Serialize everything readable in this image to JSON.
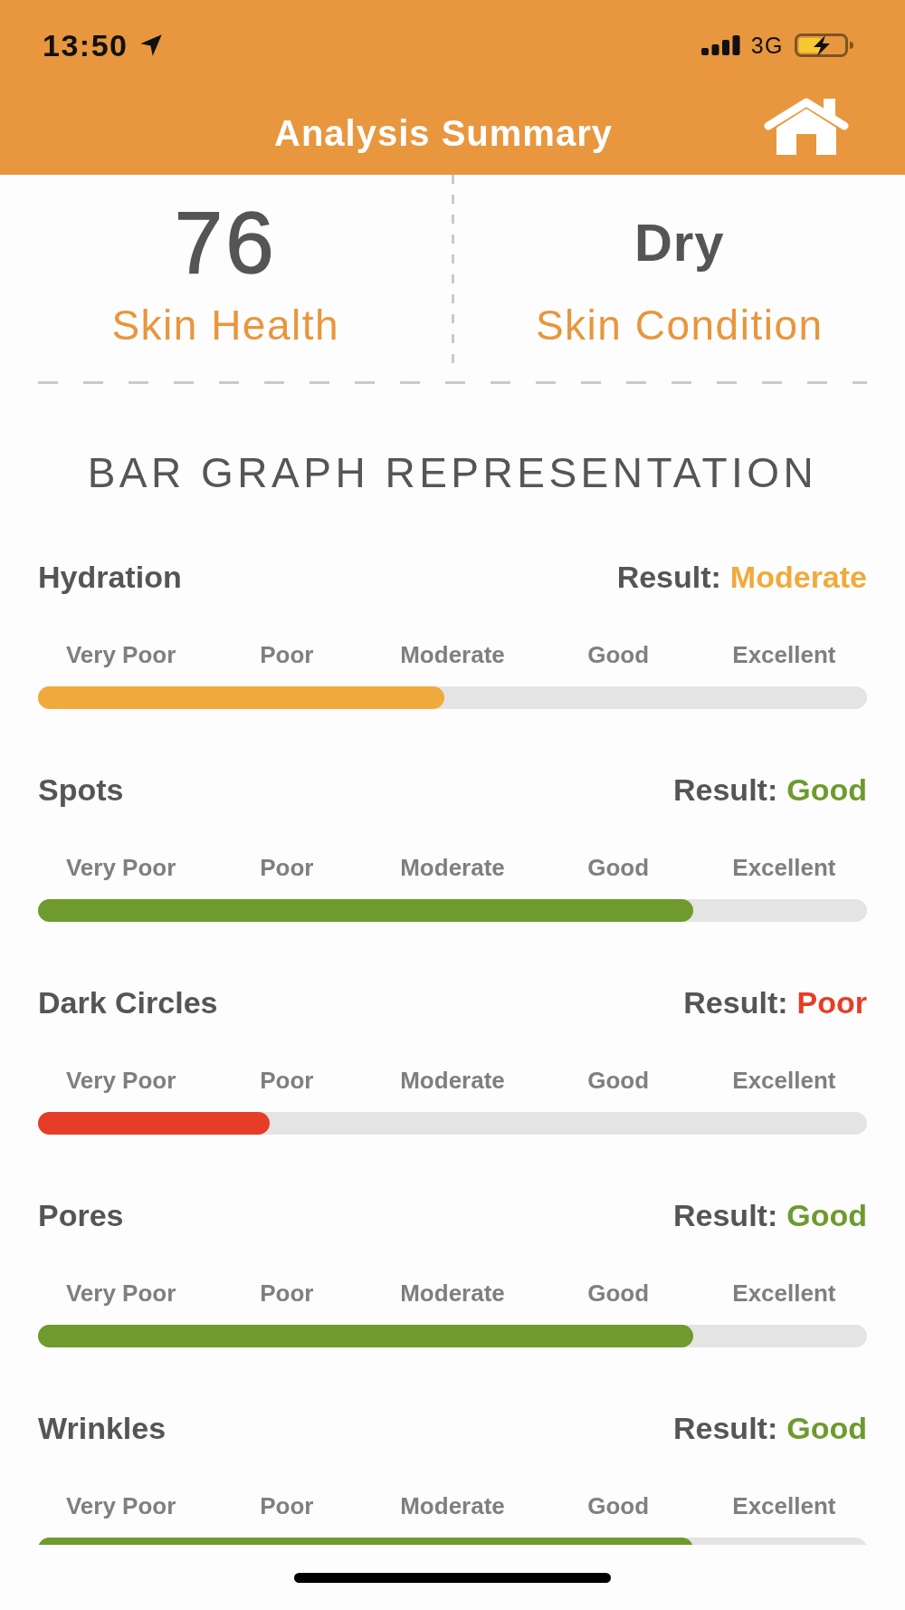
{
  "status_bar": {
    "time": "13:50",
    "network": "3G"
  },
  "header": {
    "title": "Analysis Summary"
  },
  "summary": [
    {
      "kind": "score",
      "value": "76",
      "label": "Skin Health"
    },
    {
      "kind": "condition",
      "value": "Dry",
      "label": "Skin Condition"
    }
  ],
  "section_heading": "BAR GRAPH REPRESENTATION",
  "metrics": [
    {
      "name": "Hydration",
      "result_label": "Result:",
      "result": "Moderate",
      "color": "#f0aa3b",
      "level": 0.49,
      "scale": [
        "Very Poor",
        "Poor",
        "Moderate",
        "Good",
        "Excellent"
      ]
    },
    {
      "name": "Spots",
      "result_label": "Result:",
      "result": "Good",
      "color": "#6e9a2e",
      "level": 0.79,
      "scale": [
        "Very Poor",
        "Poor",
        "Moderate",
        "Good",
        "Excellent"
      ]
    },
    {
      "name": "Dark Circles",
      "result_label": "Result:",
      "result": "Poor",
      "color": "#e63d27",
      "level": 0.28,
      "scale": [
        "Very Poor",
        "Poor",
        "Moderate",
        "Good",
        "Excellent"
      ]
    },
    {
      "name": "Pores",
      "result_label": "Result:",
      "result": "Good",
      "color": "#6e9a2e",
      "level": 0.79,
      "scale": [
        "Very Poor",
        "Poor",
        "Moderate",
        "Good",
        "Excellent"
      ]
    },
    {
      "name": "Wrinkles",
      "result_label": "Result:",
      "result": "Good",
      "color": "#6e9a2e",
      "level": 0.79,
      "scale": [
        "Very Poor",
        "Poor",
        "Moderate",
        "Good",
        "Excellent"
      ]
    }
  ]
}
